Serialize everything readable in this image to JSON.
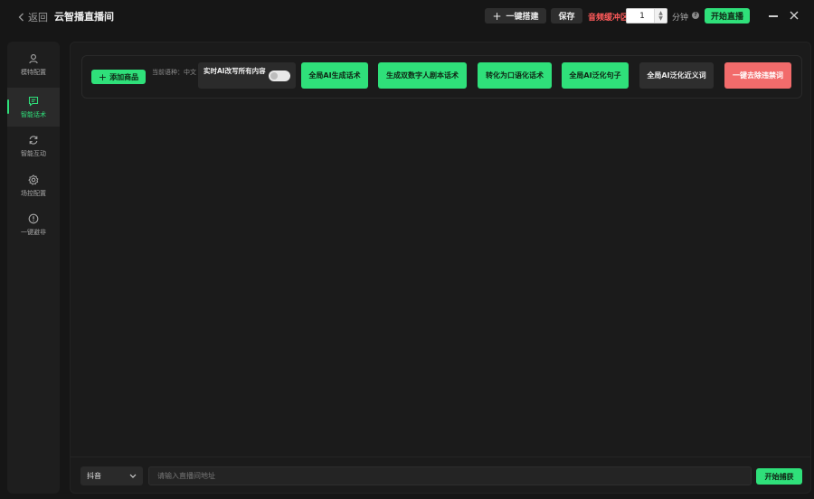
{
  "titlebar": {
    "back_label": "返回",
    "app_title": "云智播直播间",
    "one_click_label": "一键搭建",
    "save_label": "保存",
    "buffer_label": "音频缓冲区",
    "buffer_value": "1",
    "minute_label": "分钟",
    "start_live_label": "开始直播"
  },
  "sidebar": {
    "items": [
      {
        "label": "模特配置",
        "icon": "user-icon",
        "active": false
      },
      {
        "label": "智能话术",
        "icon": "chat-icon",
        "active": true
      },
      {
        "label": "智能互动",
        "icon": "refresh-icon",
        "active": false
      },
      {
        "label": "场控配置",
        "icon": "gear-icon",
        "active": false
      },
      {
        "label": "一键避非",
        "icon": "alert-icon",
        "active": false
      }
    ]
  },
  "toolbar": {
    "add_product_label": "添加商品",
    "language_label": "当前语种：中文",
    "realtime_ai_label": "实时AI改写所有内容",
    "realtime_ai_enabled": false,
    "actions": [
      {
        "label": "全局AI生成话术",
        "style": "green"
      },
      {
        "label": "生成双数字人剧本话术",
        "style": "green"
      },
      {
        "label": "转化为口语化话术",
        "style": "green"
      },
      {
        "label": "全局AI泛化句子",
        "style": "green"
      },
      {
        "label": "全局AI泛化近义词",
        "style": "dark"
      },
      {
        "label": "一键去除违禁词",
        "style": "red"
      }
    ]
  },
  "bottom": {
    "platform_value": "抖音",
    "url_placeholder": "请输入直播间地址",
    "capture_label": "开始捕获"
  },
  "colors": {
    "accent": "#2fe07a",
    "danger": "#f26b6b",
    "warning_text": "#ff5a5a",
    "background": "#161616"
  }
}
